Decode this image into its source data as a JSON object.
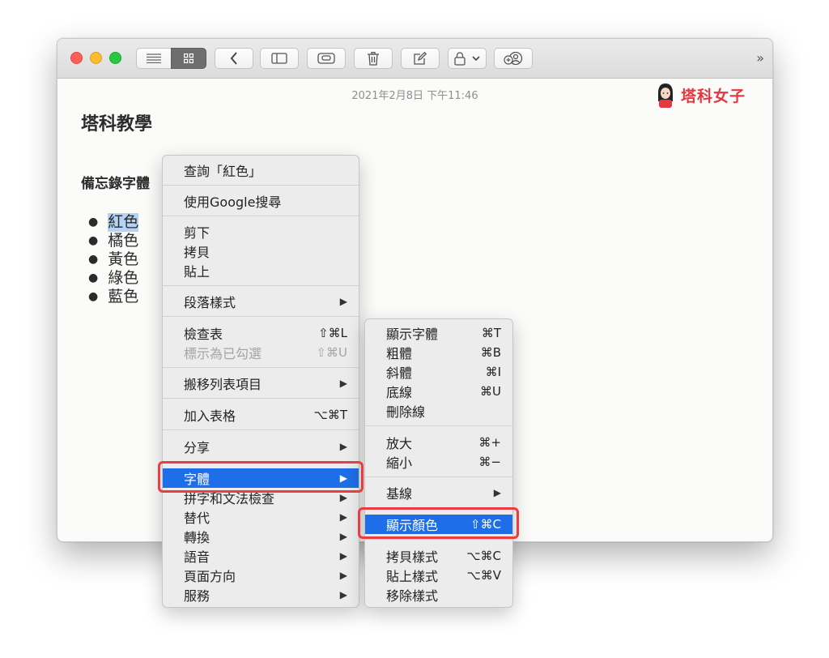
{
  "note": {
    "date": "2021年2月8日 下午11:46",
    "logo_text": "塔科女子",
    "title": "塔科教學",
    "subtitle": "備忘錄字體",
    "list": [
      "紅色",
      "橘色",
      "黃色",
      "綠色",
      "藍色"
    ]
  },
  "toolbar": {
    "overflow": "»"
  },
  "context_menu": {
    "lookup": "查詢「紅色」",
    "google": "使用Google搜尋",
    "cut": "剪下",
    "copy": "拷貝",
    "paste": "貼上",
    "paragraph_style": "段落樣式",
    "checklist": "檢查表",
    "checklist_sc": "⇧⌘L",
    "mark_checked": "標示為已勾選",
    "mark_checked_sc": "⇧⌘U",
    "move_list_item": "搬移列表項目",
    "add_table": "加入表格",
    "add_table_sc": "⌥⌘T",
    "share": "分享",
    "font": "字體",
    "spelling": "拼字和文法檢查",
    "substitutions": "替代",
    "transformations": "轉換",
    "speech": "語音",
    "layout_orientation": "頁面方向",
    "services": "服務",
    "arrow": "▶"
  },
  "font_submenu": {
    "show_fonts": "顯示字體",
    "show_fonts_sc": "⌘T",
    "bold": "粗體",
    "bold_sc": "⌘B",
    "italic": "斜體",
    "italic_sc": "⌘I",
    "underline": "底線",
    "underline_sc": "⌘U",
    "strikethrough": "刪除線",
    "bigger": "放大",
    "bigger_sc": "⌘+",
    "smaller": "縮小",
    "smaller_sc": "⌘−",
    "baseline": "基線",
    "show_colors": "顯示顏色",
    "show_colors_sc": "⇧⌘C",
    "copy_style": "拷貝樣式",
    "copy_style_sc": "⌥⌘C",
    "paste_style": "貼上樣式",
    "paste_style_sc": "⌥⌘V",
    "remove_style": "移除樣式"
  },
  "colors": {
    "highlight": "#1d6ee8",
    "annotation": "#ea3d43",
    "brand": "#e6373e",
    "selection": "#b3d4f7"
  }
}
